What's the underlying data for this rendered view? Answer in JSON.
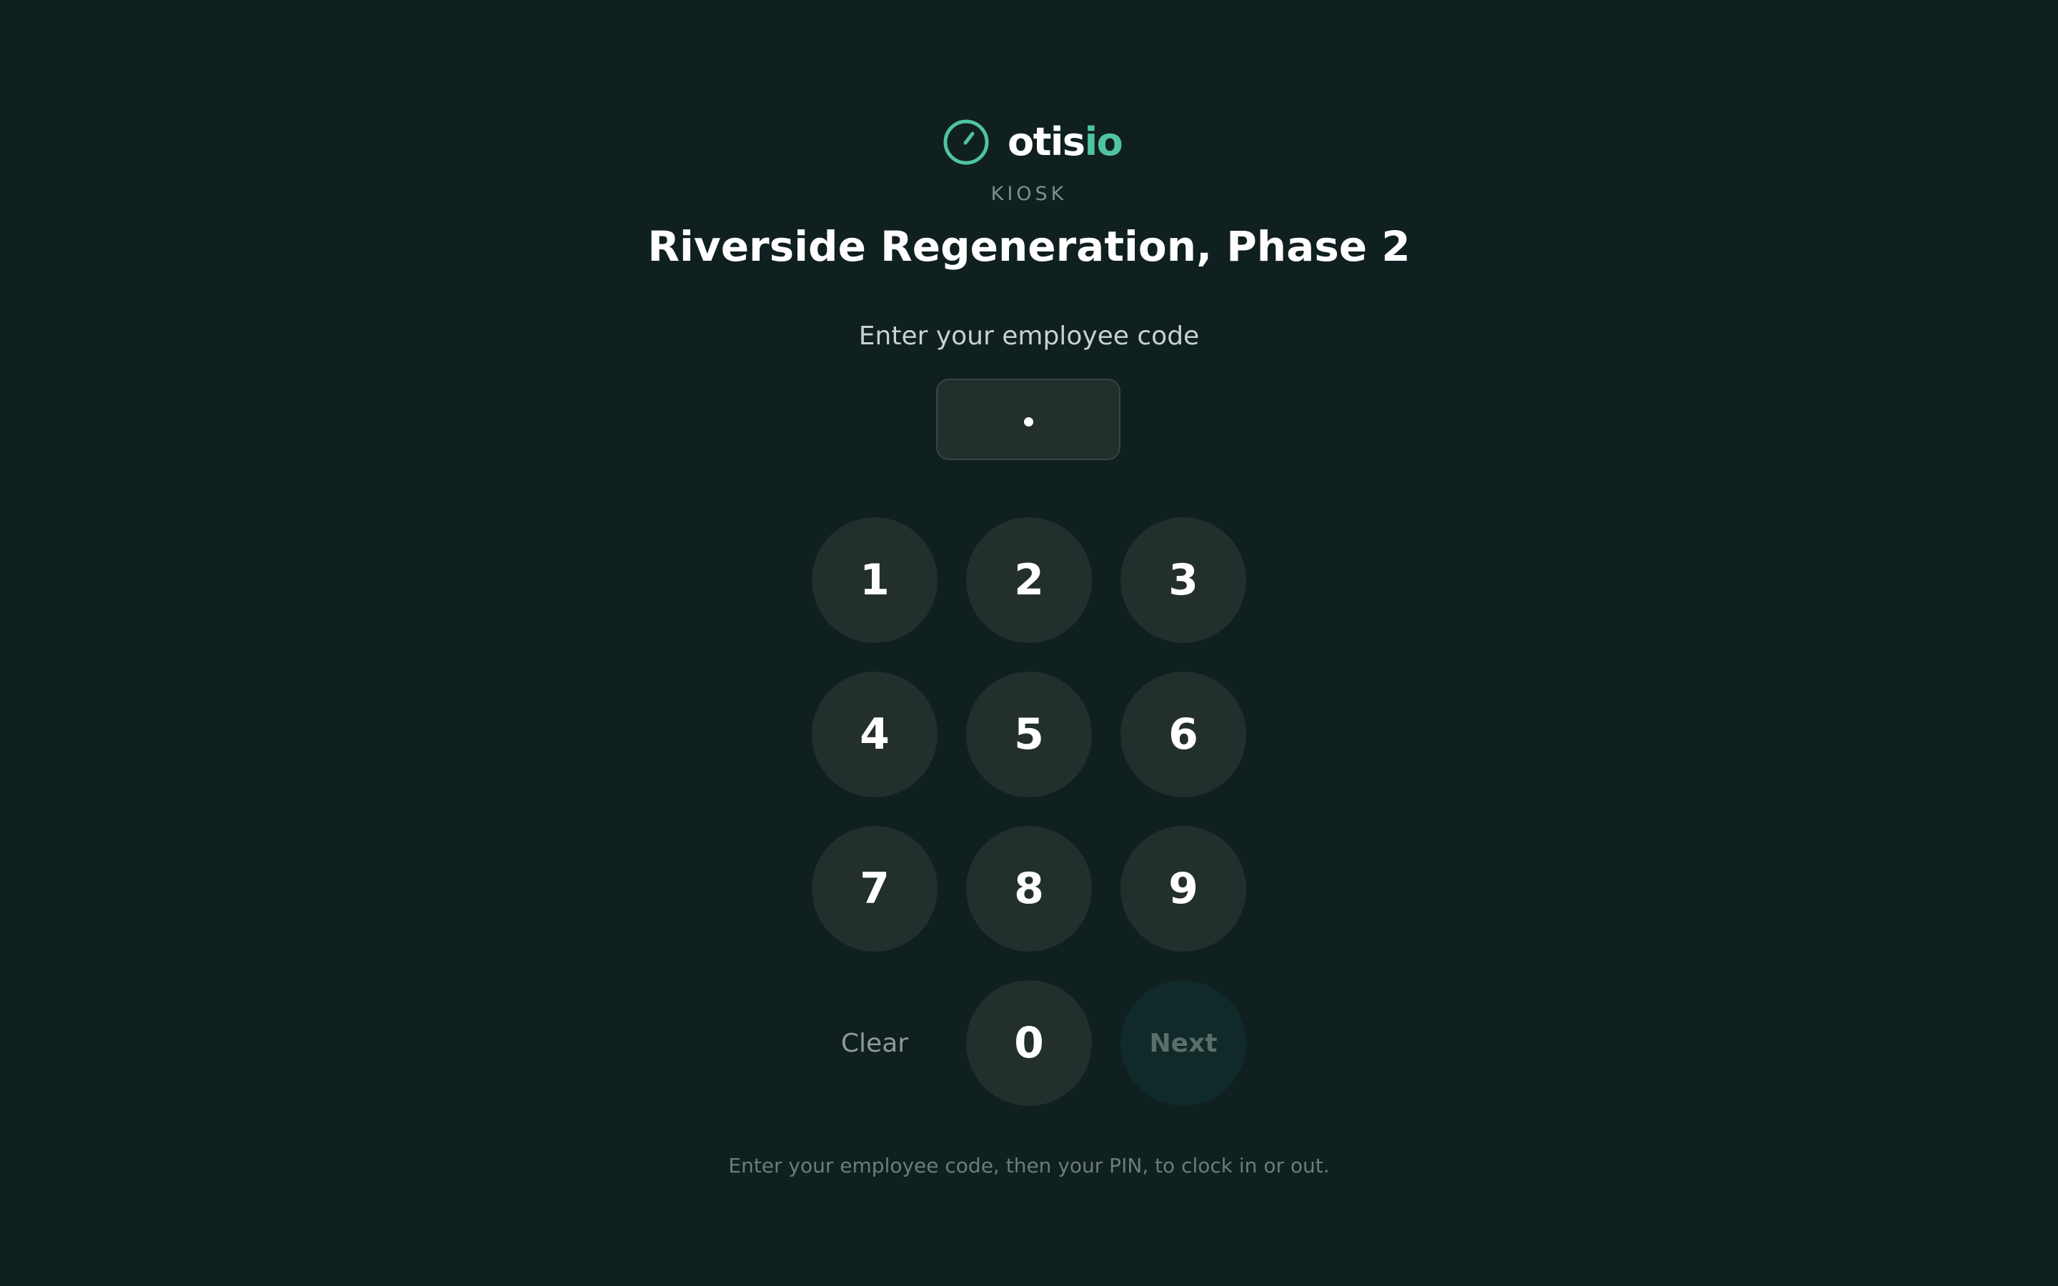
{
  "brand": {
    "name_part1": "otis",
    "name_part2": "io",
    "icon": "stopwatch-icon",
    "accent_color": "#4fc4a1"
  },
  "kiosk_label": "KIOSK",
  "site_title": "Riverside Regeneration, Phase 2",
  "code_prompt": "Enter your employee code",
  "code_input": {
    "masked_value": "•",
    "digits_entered": 1
  },
  "keypad": {
    "keys": [
      "1",
      "2",
      "3",
      "4",
      "5",
      "6",
      "7",
      "8",
      "9",
      "0"
    ],
    "clear_label": "Clear",
    "next_label": "Next"
  },
  "footer_hint": "Enter your employee code, then your PIN, to clock in or out.",
  "colors": {
    "background": "#101f1f",
    "key_background": "#222f2d",
    "next_disabled_background": "#102a29"
  }
}
